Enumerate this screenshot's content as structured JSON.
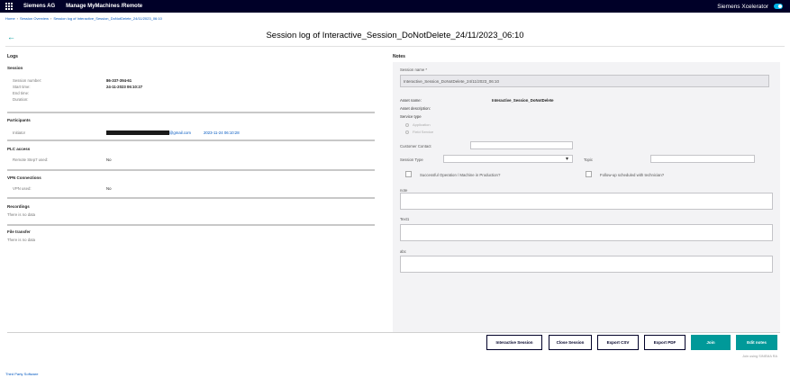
{
  "topbar": {
    "company": "Siemens AG",
    "app_name": "Manage MyMachines /Remote",
    "product": "Siemens Xcelerator"
  },
  "breadcrumb": {
    "home": "Home",
    "overview": "Session Overview",
    "current": "Session log of Interactive_Session_DoNotDelete_24/11/2023_06:10"
  },
  "page": {
    "title": "Session log of Interactive_Session_DoNotDelete_24/11/2023_06:10"
  },
  "logs": {
    "heading": "Logs",
    "session": {
      "title": "Session",
      "number_label": "Session number:",
      "number_value": "86-337-394-61",
      "start_label": "Start time:",
      "start_value": "24-11-2023 06:10:27",
      "end_label": "End time:",
      "duration_label": "Duration:"
    },
    "participants": {
      "title": "Participants",
      "initiator_label": "Initiator",
      "email_suffix": "@gmail.com",
      "timestamp": "2023-11-24 06:10:28"
    },
    "plc": {
      "title": "PLC access",
      "label": "Remote Step7 used:",
      "value": "No"
    },
    "vpn": {
      "title": "VPN Connections",
      "label": "VPN used:",
      "value": "No"
    },
    "recordings": {
      "title": "Recordings",
      "empty": "There is no data"
    },
    "file_transfer": {
      "title": "File transfer",
      "empty": "There is no data"
    }
  },
  "notes": {
    "heading": "Notes",
    "session_name_label": "Session name *",
    "session_name_value": "Interactive_Session_DoNotDelete_24/11/2023_06:10",
    "asset_name_label": "Asset name:",
    "asset_name_value": "Interactive_Session_DoNotDelete",
    "asset_description_label": "Asset description:",
    "service_type_label": "Service type",
    "radio_1": "Application",
    "radio_2": "Field Service",
    "customer_contact_label": "Customer Contact",
    "session_type_label": "Session Type",
    "topic_label": "Topic",
    "checkbox_1": "Successful Operation / Machine in Production?",
    "checkbox_2": "Follow-up scheduled with technician?",
    "text1_label": "note",
    "text2_label": "Text1",
    "text3_label": "abc"
  },
  "actions": {
    "interactive_session": "Interactive Session",
    "close_session": "Close Session",
    "export_csv": "Export CSV",
    "export_pdf": "Export PDF",
    "join": "Join",
    "edit_notes": "Edit notes",
    "footer_note": "Join using SINEMA RA"
  },
  "footer": {
    "third_party": "Third Party Software"
  },
  "colors": {
    "topbar": "#000028",
    "accent": "#009999",
    "link": "#0057c0"
  }
}
